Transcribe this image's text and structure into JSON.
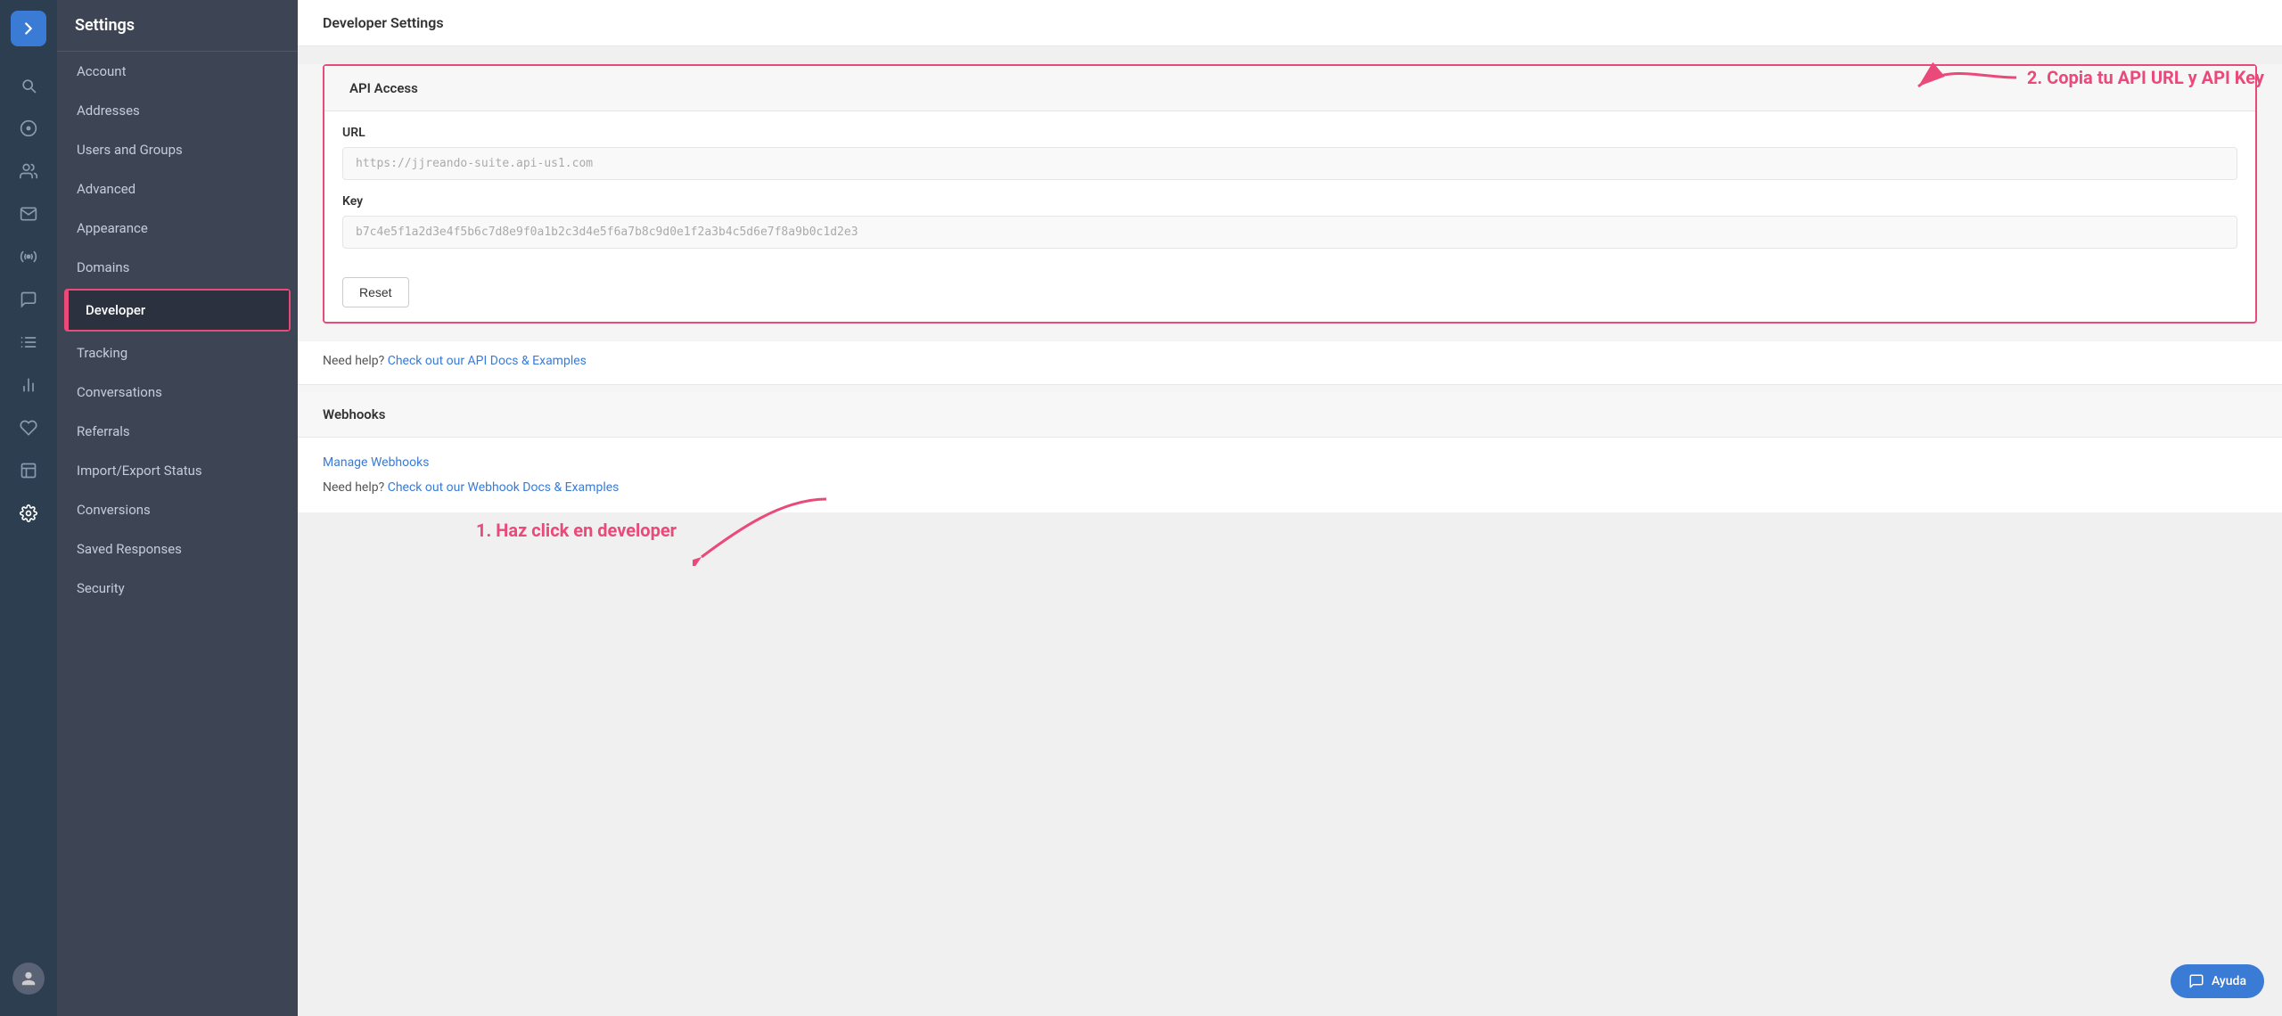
{
  "app": {
    "title": "Settings"
  },
  "page": {
    "title": "Developer Settings"
  },
  "sidebar": {
    "items": [
      {
        "id": "account",
        "label": "Account",
        "active": false
      },
      {
        "id": "addresses",
        "label": "Addresses",
        "active": false
      },
      {
        "id": "users-groups",
        "label": "Users and Groups",
        "active": false
      },
      {
        "id": "advanced",
        "label": "Advanced",
        "active": false
      },
      {
        "id": "appearance",
        "label": "Appearance",
        "active": false
      },
      {
        "id": "domains",
        "label": "Domains",
        "active": false
      },
      {
        "id": "developer",
        "label": "Developer",
        "active": true
      },
      {
        "id": "tracking",
        "label": "Tracking",
        "active": false
      },
      {
        "id": "conversations",
        "label": "Conversations",
        "active": false
      },
      {
        "id": "referrals",
        "label": "Referrals",
        "active": false
      },
      {
        "id": "import-export",
        "label": "Import/Export Status",
        "active": false
      },
      {
        "id": "conversions",
        "label": "Conversions",
        "active": false
      },
      {
        "id": "saved-responses",
        "label": "Saved Responses",
        "active": false
      },
      {
        "id": "security",
        "label": "Security",
        "active": false
      }
    ]
  },
  "api_access": {
    "section_title": "API Access",
    "url_label": "URL",
    "url_value": "https://jjreando-suite.api-us1.com",
    "key_label": "Key",
    "key_value": "b7c4e5f1a2d3e4f5b6c7d8e9f0a1b2c3d4e5f6a7b8c9d0e1f2a3b4c5d6e7f8a9b0c1d2e3",
    "reset_label": "Reset",
    "help_prefix": "Need help?",
    "help_link": "Check out our API Docs & Examples"
  },
  "webhooks": {
    "section_title": "Webhooks",
    "manage_link": "Manage Webhooks",
    "help_prefix": "Need help?",
    "help_link": "Check out our Webhook Docs & Examples"
  },
  "annotations": {
    "step1": "1. Haz click en developer",
    "step2": "2. Copia tu API URL y API Key"
  },
  "ayuda": {
    "label": "Ayuda"
  },
  "icons": {
    "chevron_right": "❯",
    "search": "🔍",
    "person_circle": "👤",
    "users": "👥",
    "mail": "✉",
    "integrations": "⚙",
    "chat": "💬",
    "list": "☰",
    "reports": "📊",
    "heart": "♥",
    "copy": "⧉",
    "settings": "⚙",
    "chat_bubble": "💬"
  }
}
